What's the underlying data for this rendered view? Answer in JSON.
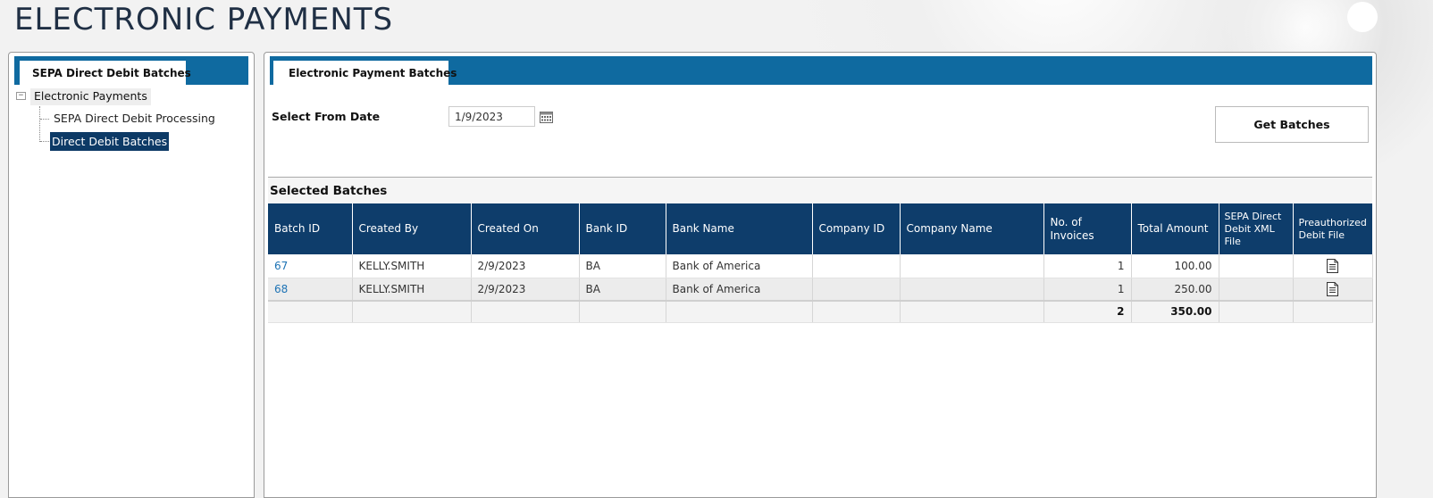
{
  "page": {
    "title": "ELECTRONIC PAYMENTS"
  },
  "left_panel": {
    "tab_label": "SEPA Direct Debit Batches",
    "tree": {
      "toggle": "−",
      "root": "Electronic Payments",
      "children": [
        "SEPA Direct Debit Processing",
        "Direct Debit Batches"
      ],
      "selected": "Direct Debit Batches"
    }
  },
  "right_panel": {
    "tab_label": "Electronic Payment Batches",
    "date_label": "Select From Date",
    "date_value": "1/9/2023",
    "get_batches_label": "Get Batches",
    "section_title": "Selected Batches",
    "table": {
      "columns": [
        "Batch ID",
        "Created By",
        "Created On",
        "Bank ID",
        "Bank Name",
        "Company ID",
        "Company Name",
        "No. of Invoices",
        "Total Amount",
        "SEPA Direct Debit XML File",
        "Preauthorized Debit File"
      ],
      "rows": [
        {
          "batch_id": "67",
          "created_by": "KELLY.SMITH",
          "created_on": "2/9/2023",
          "bank_id": "BA",
          "bank_name": "Bank of America",
          "company_id": "",
          "company_name": "",
          "invoices": "1",
          "total": "100.00",
          "sepa_file": "",
          "pad_file_icon": "document-icon"
        },
        {
          "batch_id": "68",
          "created_by": "KELLY.SMITH",
          "created_on": "2/9/2023",
          "bank_id": "BA",
          "bank_name": "Bank of America",
          "company_id": "",
          "company_name": "",
          "invoices": "1",
          "total": "250.00",
          "sepa_file": "",
          "pad_file_icon": "document-icon"
        }
      ],
      "footer": {
        "invoices_total": "2",
        "amount_total": "350.00"
      }
    }
  },
  "colors": {
    "tab_bar": "#0f6aa0",
    "header": "#0e3d6b",
    "selected_node": "#0d3a66",
    "link": "#1d73b5"
  }
}
